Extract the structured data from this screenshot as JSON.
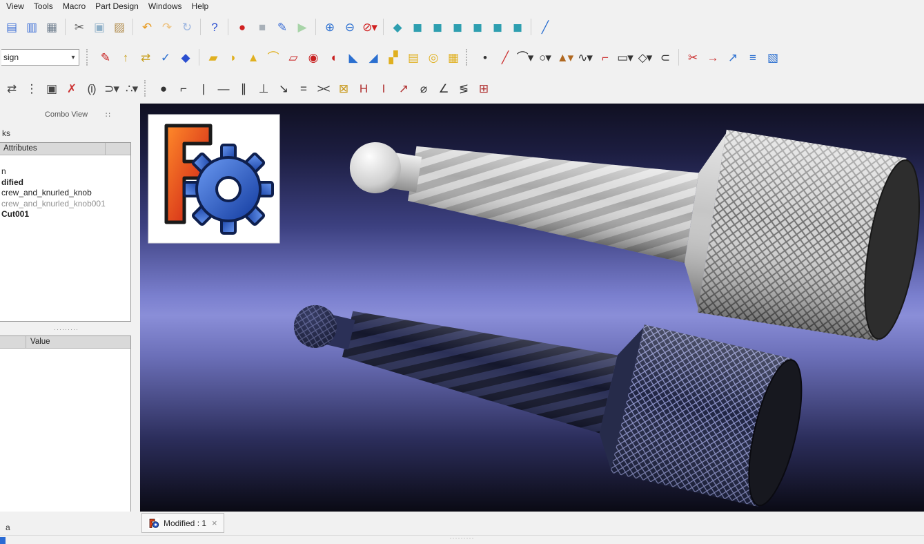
{
  "menu": {
    "items": [
      {
        "name": "menu-view",
        "label": "View"
      },
      {
        "name": "menu-tools",
        "label": "Tools"
      },
      {
        "name": "menu-macro",
        "label": "Macro"
      },
      {
        "name": "menu-part-design",
        "label": "Part Design"
      },
      {
        "name": "menu-windows",
        "label": "Windows"
      },
      {
        "name": "menu-help",
        "label": "Help"
      }
    ]
  },
  "workbench": {
    "value": "sign",
    "caret": "▾"
  },
  "toolbar_file": {
    "icons": [
      {
        "name": "open-icon",
        "glyph": "▤",
        "c": "#3d6fd6"
      },
      {
        "name": "save-icon",
        "glyph": "▥",
        "c": "#3d6fd6"
      },
      {
        "name": "print-icon",
        "glyph": "▦",
        "c": "#6b7b8c"
      },
      {
        "sep": true
      },
      {
        "name": "cut-icon",
        "glyph": "✂",
        "c": "#555555"
      },
      {
        "name": "copy-icon",
        "glyph": "▣",
        "c": "#8fb0c8"
      },
      {
        "name": "paste-icon",
        "glyph": "▨",
        "c": "#b08a4a"
      },
      {
        "sep": true
      },
      {
        "name": "undo-icon",
        "glyph": "↶",
        "c": "#e8991d"
      },
      {
        "name": "redo-icon",
        "glyph": "↷",
        "c": "#edc17d"
      },
      {
        "name": "refresh-icon",
        "glyph": "↻",
        "c": "#9db6e0"
      },
      {
        "sep": true
      },
      {
        "name": "whats-this-icon",
        "glyph": "?",
        "c": "#2b4fd0"
      },
      {
        "sep": true
      },
      {
        "name": "macro-record-icon",
        "glyph": "●",
        "c": "#d02020"
      },
      {
        "name": "macro-stop-icon",
        "glyph": "■",
        "c": "#a8b0b8"
      },
      {
        "name": "macro-edit-icon",
        "glyph": "✎",
        "c": "#3d6fd6"
      },
      {
        "name": "macro-play-icon",
        "glyph": "▶",
        "c": "#a8d4a8"
      },
      {
        "sep": true
      },
      {
        "name": "zoom-box-icon",
        "glyph": "⊕",
        "c": "#2b6fd0"
      },
      {
        "name": "zoom-fit-icon",
        "glyph": "⊖",
        "c": "#2b6fd0"
      },
      {
        "name": "draw-style-icon",
        "glyph": "⊘▾",
        "c": "#d02020"
      },
      {
        "sep": true
      },
      {
        "name": "view-axonometric-icon",
        "glyph": "◆",
        "c": "#2e9fb0"
      },
      {
        "name": "view-front-icon",
        "glyph": "◼",
        "c": "#2e9fb0"
      },
      {
        "name": "view-top-icon",
        "glyph": "◼",
        "c": "#2e9fb0"
      },
      {
        "name": "view-right-icon",
        "glyph": "◼",
        "c": "#2e9fb0"
      },
      {
        "name": "view-rear-icon",
        "glyph": "◼",
        "c": "#2e9fb0"
      },
      {
        "name": "view-bottom-icon",
        "glyph": "◼",
        "c": "#2e9fb0"
      },
      {
        "name": "view-left-icon",
        "glyph": "◼",
        "c": "#2e9fb0"
      },
      {
        "sep": true
      },
      {
        "name": "measure-icon",
        "glyph": "╱",
        "c": "#2b6fd0"
      }
    ]
  },
  "toolbar_partdesign": {
    "icons": [
      {
        "grip": true
      },
      {
        "name": "create-sketch-icon",
        "glyph": "✎",
        "c": "#c82020"
      },
      {
        "name": "map-sketch-icon",
        "glyph": "↑",
        "c": "#c8a020"
      },
      {
        "name": "reorient-sketch-icon",
        "glyph": "⇄",
        "c": "#c8a020"
      },
      {
        "name": "validate-sketch-icon",
        "glyph": "✓",
        "c": "#2b6fd0"
      },
      {
        "name": "create-body-icon",
        "glyph": "◆",
        "c": "#2b4fd0"
      },
      {
        "sep": true
      },
      {
        "name": "pad-icon",
        "glyph": "▰",
        "c": "#e0b020"
      },
      {
        "name": "revolution-icon",
        "glyph": "◗",
        "c": "#e0b020"
      },
      {
        "name": "additive-loft-icon",
        "glyph": "▲",
        "c": "#e0b020"
      },
      {
        "name": "additive-pipe-icon",
        "glyph": "⌒",
        "c": "#e0b020"
      },
      {
        "name": "pocket-icon",
        "glyph": "▱",
        "c": "#c82020"
      },
      {
        "name": "hole-icon",
        "glyph": "◉",
        "c": "#c82020"
      },
      {
        "name": "groove-icon",
        "glyph": "◖",
        "c": "#c82020"
      },
      {
        "name": "fillet-icon",
        "glyph": "◣",
        "c": "#2b6fd0"
      },
      {
        "name": "chamfer-icon",
        "glyph": "◢",
        "c": "#2b6fd0"
      },
      {
        "name": "mirrored-icon",
        "glyph": "▞",
        "c": "#e0b020"
      },
      {
        "name": "linear-pattern-icon",
        "glyph": "▤",
        "c": "#e0b020"
      },
      {
        "name": "polar-pattern-icon",
        "glyph": "◎",
        "c": "#e0b020"
      },
      {
        "name": "multi-transform-icon",
        "glyph": "▦",
        "c": "#e0b020"
      },
      {
        "grip": true
      },
      {
        "name": "point-icon",
        "glyph": "•",
        "c": "#333333"
      },
      {
        "name": "line-icon",
        "glyph": "╱",
        "c": "#cc3333"
      },
      {
        "name": "arc-icon",
        "glyph": "⌒▾",
        "c": "#333333"
      },
      {
        "name": "circle-icon",
        "glyph": "○▾",
        "c": "#333333"
      },
      {
        "name": "conic-icon",
        "glyph": "▲▾",
        "c": "#b06820"
      },
      {
        "name": "bspline-icon",
        "glyph": "∿▾",
        "c": "#333333"
      },
      {
        "name": "polyline-icon",
        "glyph": "⌐",
        "c": "#cc3333"
      },
      {
        "name": "rectangle-icon",
        "glyph": "▭▾",
        "c": "#333333"
      },
      {
        "name": "polygon-icon",
        "glyph": "◇▾",
        "c": "#333333"
      },
      {
        "name": "slot-icon",
        "glyph": "⊂",
        "c": "#333333"
      },
      {
        "sep": true
      },
      {
        "name": "trim-icon",
        "glyph": "✂",
        "c": "#cc3333"
      },
      {
        "name": "extend-icon",
        "glyph": "→",
        "c": "#cc3333"
      },
      {
        "name": "external-geometry-icon",
        "glyph": "↗",
        "c": "#2b6fd0"
      },
      {
        "name": "carbon-copy-icon",
        "glyph": "≡",
        "c": "#2b6fd0"
      },
      {
        "name": "construction-mode-icon",
        "glyph": "▧",
        "c": "#2b6fd0"
      }
    ]
  },
  "toolbar_sketcher": {
    "icons": [
      {
        "name": "convert-geometry-icon",
        "glyph": "⇄",
        "c": "#444444"
      },
      {
        "name": "select-constraints-icon",
        "glyph": "⋮",
        "c": "#444444"
      },
      {
        "name": "internal-geometry-icon",
        "glyph": "▣",
        "c": "#444444"
      },
      {
        "name": "delete-all-geometry-icon",
        "glyph": "✗",
        "c": "#cc3333"
      },
      {
        "name": "sketch-info-icon",
        "glyph": "(i)",
        "c": "#444444"
      },
      {
        "name": "close-shape-icon",
        "glyph": "⊃▾",
        "c": "#444444"
      },
      {
        "name": "connect-edges-icon",
        "glyph": "∴▾",
        "c": "#444444"
      },
      {
        "grip": true
      },
      {
        "name": "constraint-coincident-icon",
        "glyph": "●",
        "c": "#333333"
      },
      {
        "name": "constraint-point-on-object-icon",
        "glyph": "⌐",
        "c": "#333333"
      },
      {
        "name": "constraint-vertical-icon",
        "glyph": "|",
        "c": "#333333"
      },
      {
        "name": "constraint-horizontal-icon",
        "glyph": "—",
        "c": "#333333"
      },
      {
        "name": "constraint-parallel-icon",
        "glyph": "∥",
        "c": "#333333"
      },
      {
        "name": "constraint-perpendicular-icon",
        "glyph": "⊥",
        "c": "#333333"
      },
      {
        "name": "constraint-tangent-icon",
        "glyph": "↘",
        "c": "#333333"
      },
      {
        "name": "constraint-equal-icon",
        "glyph": "=",
        "c": "#333333"
      },
      {
        "name": "constraint-symmetric-icon",
        "glyph": "><",
        "c": "#333333"
      },
      {
        "name": "constraint-block-icon",
        "glyph": "⊠",
        "c": "#c8981a"
      },
      {
        "name": "constraint-horizontal-distance-icon",
        "glyph": "H",
        "c": "#b03030"
      },
      {
        "name": "constraint-vertical-distance-icon",
        "glyph": "I",
        "c": "#b03030"
      },
      {
        "name": "constraint-distance-icon",
        "glyph": "↗",
        "c": "#b03030"
      },
      {
        "name": "constraint-radius-icon",
        "glyph": "⌀",
        "c": "#333333"
      },
      {
        "name": "constraint-angle-icon",
        "glyph": "∠",
        "c": "#333333"
      },
      {
        "name": "constraint-snell-icon",
        "glyph": "≶",
        "c": "#333333"
      },
      {
        "name": "toggle-driving-constraint-icon",
        "glyph": "⊞",
        "c": "#b03030"
      }
    ]
  },
  "combo_view": {
    "title": "Combo View",
    "dock_icon": "∷",
    "tab_fragment": "ks",
    "tree_header": "Attributes",
    "tree_items": [
      {
        "name": "tree-item-n",
        "label": "n",
        "cls": "t-normal"
      },
      {
        "name": "tree-item-modified",
        "label": "dified",
        "cls": "t-bold"
      },
      {
        "name": "tree-item-screw-and-knurled-knob",
        "label": "crew_and_knurled_knob",
        "cls": "t-normal"
      },
      {
        "name": "tree-item-screw-and-knurled-knob-001",
        "label": "crew_and_knurled_knob001",
        "cls": "t-dim"
      },
      {
        "name": "tree-item-cut001",
        "label": "Cut001",
        "cls": "t-bold"
      }
    ],
    "property_value_header": "Value",
    "bottom_fragment": "a"
  },
  "document_tab": {
    "label": "Modified : 1",
    "close_label": "×"
  },
  "ui": {
    "splitter_dots": "·········",
    "statusbar_dots": "·········"
  },
  "viewport": {
    "background_gradient": [
      "#101022",
      "#3c4080",
      "#8a8ed8",
      "#2c2e5c",
      "#0a0a14"
    ],
    "logo_colors": {
      "f_orange": "#ff8a2a",
      "f_red": "#c81414",
      "gear_blue": "#2b59c8"
    },
    "screw_shaded_color": "#cfcfcf",
    "screw_mesh_color": "#2b3057",
    "knob_face_color": "#2d2d2d"
  }
}
